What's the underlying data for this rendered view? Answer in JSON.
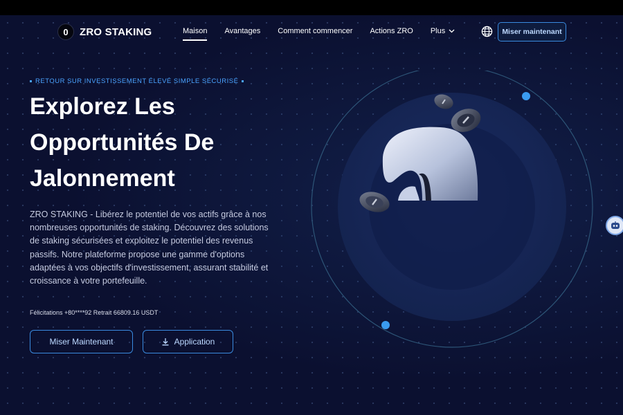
{
  "header": {
    "brand": "ZRO STAKING",
    "brand_mark": "0",
    "nav": [
      {
        "label": "Maison",
        "active": true
      },
      {
        "label": "Avantages"
      },
      {
        "label": "Comment commencer"
      },
      {
        "label": "Actions ZRO"
      },
      {
        "label": "Plus"
      }
    ],
    "language_icon": "globe-icon",
    "cta_label": "Miser maintenant"
  },
  "hero": {
    "tagline": "RETOUR SUR INVESTISSEMENT ÉLEVÉ SIMPLE SÉCURISÉ",
    "title_lines": [
      "Explorez Les",
      "Opportunités De",
      "Jalonnement"
    ],
    "description": "ZRO STAKING - Libérez le potentiel de vos actifs grâce à nos nombreuses opportunités de staking. Découvrez des solutions de staking sécurisées et exploitez le potentiel des revenus passifs. Notre plateforme propose une gamme d'options adaptées à vos objectifs d'investissement, assurant stabilité et croissance à votre portefeuille.",
    "congrats": "Félicitations +80****92 Retrait 66809.16 USDT",
    "primary_button": "Miser Maintenant",
    "secondary_button": "Application",
    "secondary_icon": "download-icon"
  },
  "colors": {
    "background": "#0b1030",
    "accent": "#3a8be0",
    "accent_text": "#4aa3ff"
  },
  "support_icon": "chat-bot-icon"
}
